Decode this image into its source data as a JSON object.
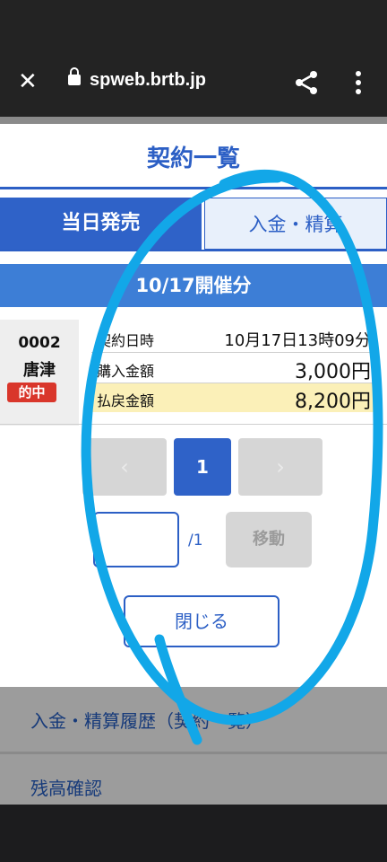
{
  "browser": {
    "url": "spweb.brtb.jp"
  },
  "modal": {
    "title": "契約一覧",
    "tabs": {
      "today": "当日発売",
      "deposit": "入金・精算"
    },
    "date_header": "10/17開催分",
    "contract": {
      "race_number": "0002",
      "venue": "唐津",
      "status_badge": "的中",
      "rows": [
        {
          "label": "契約日時",
          "value": "10月17日13時09分"
        },
        {
          "label": "購入金額",
          "value": "3,000円"
        },
        {
          "label": "払戻金額",
          "value": "8,200円"
        }
      ]
    },
    "pagination": {
      "prev": "‹",
      "current": "1",
      "next": "›",
      "page_input_value": "",
      "total": "/1",
      "move_label": "移動"
    },
    "close_label": "閉じる"
  },
  "background_menu": [
    {
      "label": "入金・精算履歴（契約一覧）"
    },
    {
      "label": "残高確認"
    }
  ],
  "colors": {
    "accent": "#2c5fc5",
    "header_blue": "#3d7ed6",
    "hit_red": "#d9362b",
    "annotation": "#12a7e8"
  },
  "icons": [
    "close-icon",
    "lock-icon",
    "share-icon",
    "more-vert-icon"
  ]
}
